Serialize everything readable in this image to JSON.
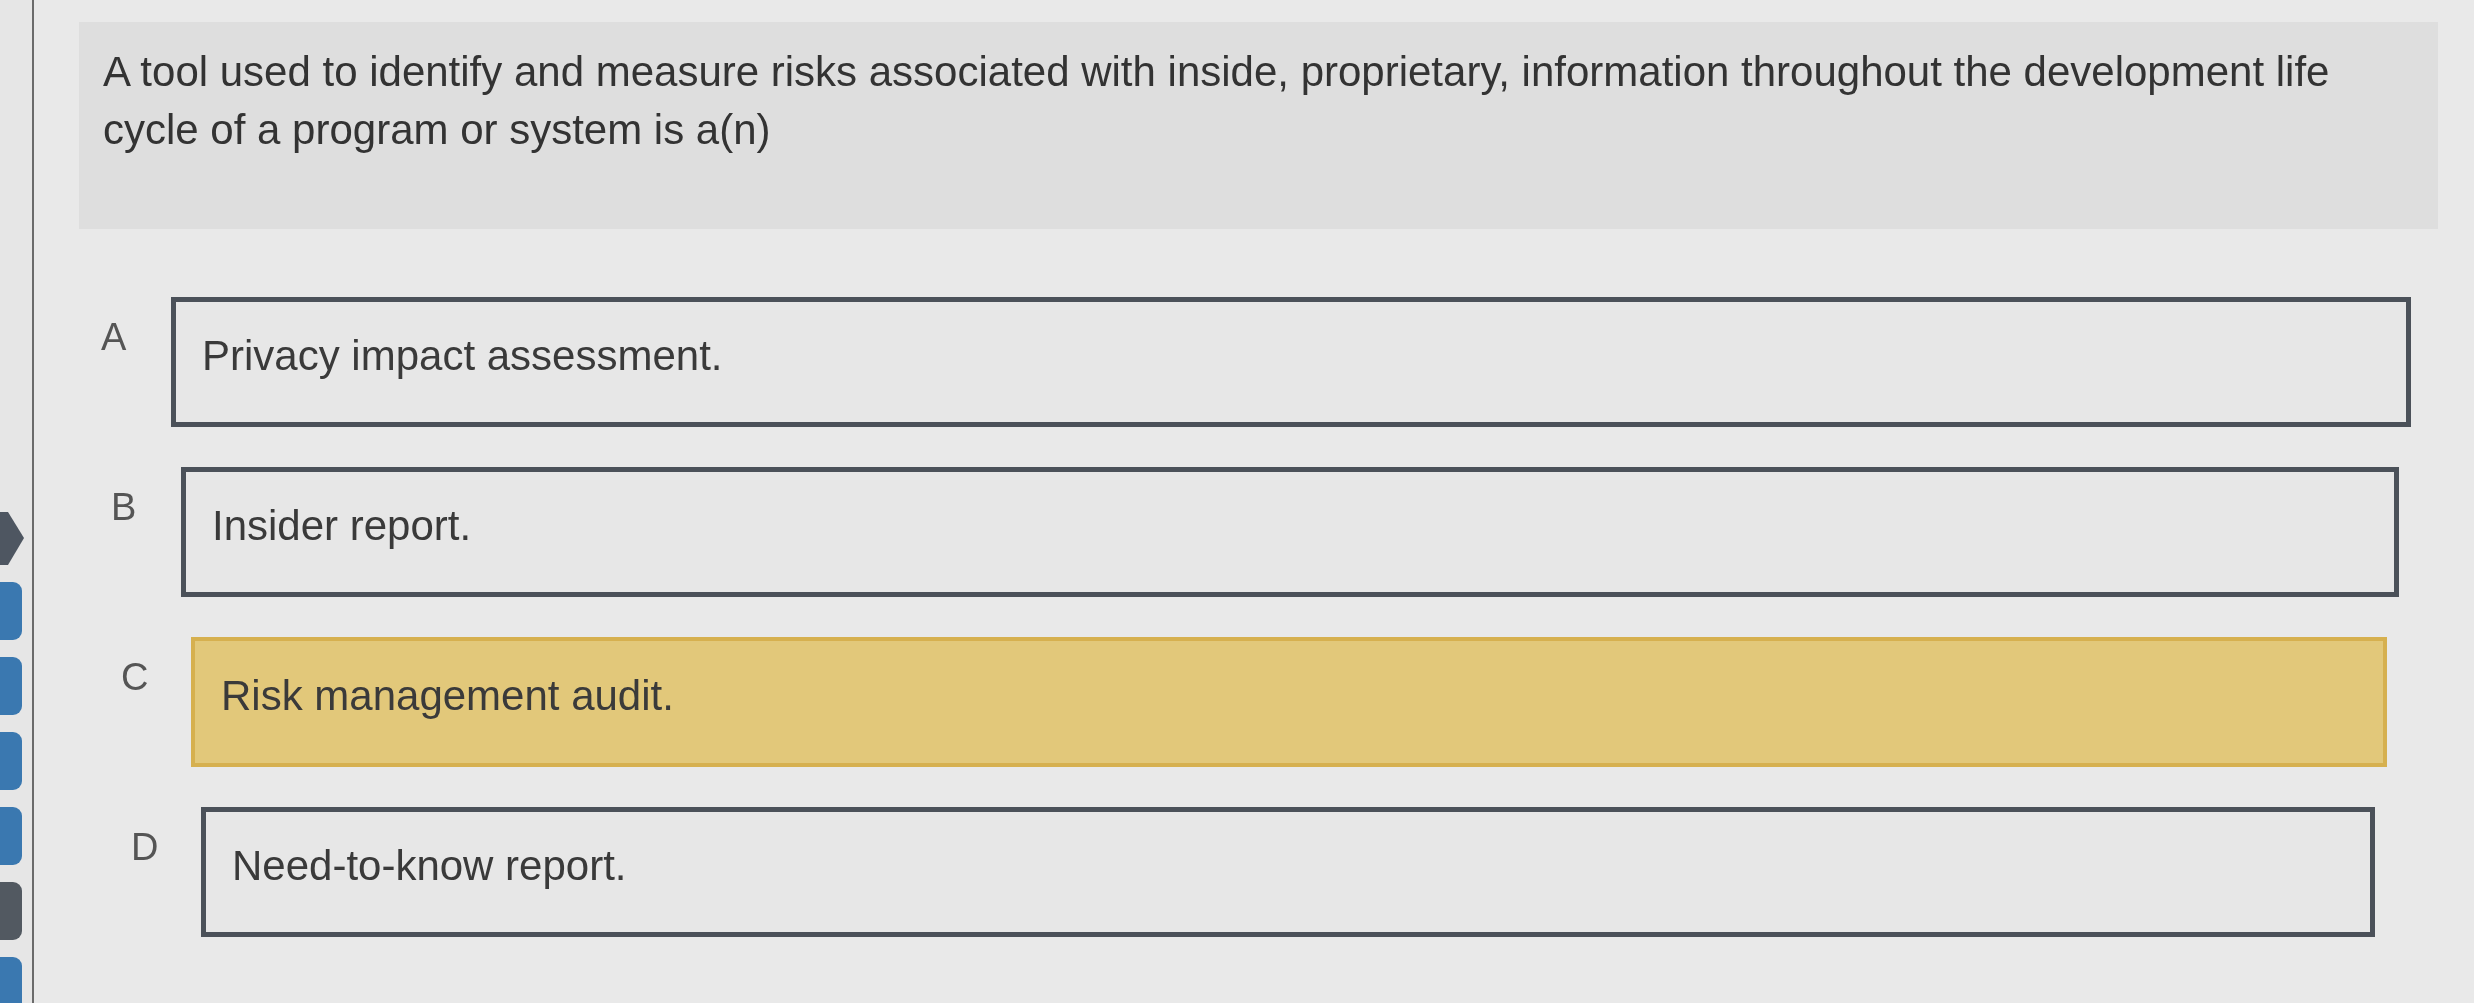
{
  "sidebar": {
    "markers": [
      {
        "kind": "pointer",
        "color": "#4e5661"
      },
      {
        "kind": "tab",
        "color": "#3a78b0"
      },
      {
        "kind": "tab",
        "color": "#3a78b0"
      },
      {
        "kind": "tab",
        "color": "#3a78b0"
      },
      {
        "kind": "tab",
        "color": "#3a78b0"
      },
      {
        "kind": "tab",
        "color": "#525961"
      },
      {
        "kind": "tab",
        "color": "#3a78b0"
      }
    ]
  },
  "question": {
    "text": "A tool used to identify and measure risks associated with inside, proprietary, information throughout the development life cycle of a program or system is a(n)"
  },
  "options": [
    {
      "letter": "A",
      "text": "Privacy impact assessment.",
      "selected": false
    },
    {
      "letter": "B",
      "text": "Insider report.",
      "selected": false
    },
    {
      "letter": "C",
      "text": "Risk management audit.",
      "selected": true
    },
    {
      "letter": "D",
      "text": "Need-to-know report.",
      "selected": false
    }
  ]
}
